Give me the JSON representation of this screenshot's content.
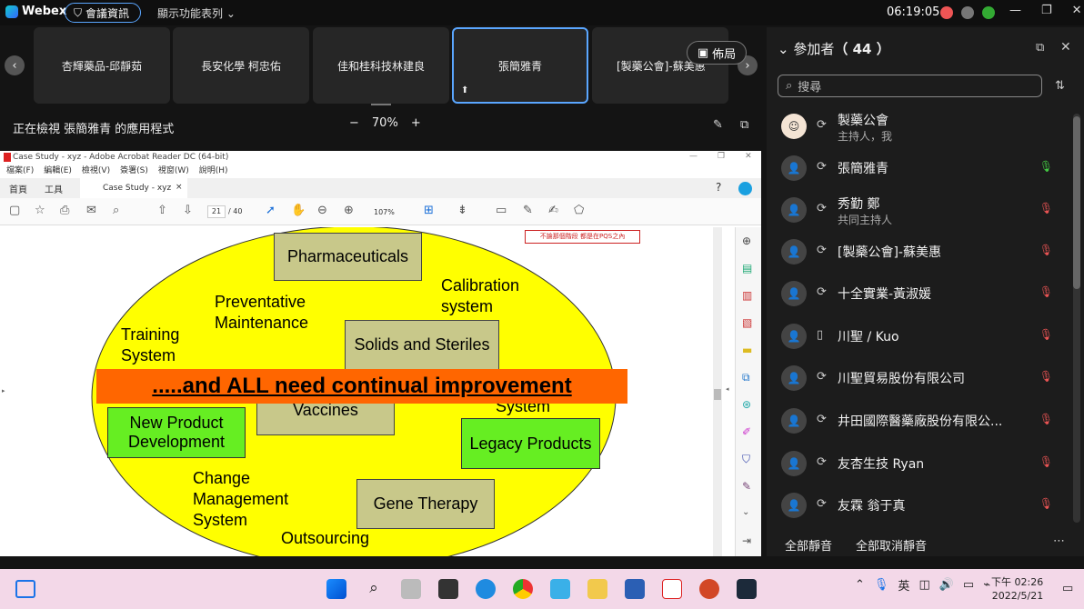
{
  "app": {
    "name": "Webex",
    "meeting_info": "會議資訊",
    "show_menu": "顯示功能表列",
    "clock": "06:19:05"
  },
  "strip": {
    "tiles": [
      "杏輝藥品-邱靜茹",
      "長安化學 柯忠佑",
      "佳和桂科技林建良",
      "張簡雅青",
      "[製藥公會]-蘇美惠"
    ],
    "layout": "佈局"
  },
  "viewing": {
    "text": "正在檢視 張簡雅青 的應用程式",
    "zoom": "70%"
  },
  "doc": {
    "window_title": "Case Study - xyz - Adobe Acrobat Reader DC (64-bit)",
    "menu": [
      "檔案(F)",
      "編輯(E)",
      "檢視(V)",
      "簽署(S)",
      "視窗(W)",
      "說明(H)"
    ],
    "tabs": [
      "首頁",
      "工具",
      "Case Study - xyz"
    ],
    "page_num": "21",
    "page_total": "/ 40",
    "zoom": "107%",
    "note": "不論那個階段 都是在PQS之內",
    "slide": {
      "pharma": "Pharmaceuticals",
      "calib": "Calibration\nsystem",
      "prevent": "Preventative\nMaintenance",
      "training": "Training\nSystem",
      "solids": "Solids and Steriles",
      "banner": ".....and ALL need continual improvement",
      "vaccines": "Vaccines",
      "system": "System",
      "newprod": "New Product\nDevelopment",
      "legacy": "Legacy Products",
      "change": "Change\nManagement\nSystem",
      "gene": "Gene Therapy",
      "outsourcing": "Outsourcing"
    }
  },
  "panel": {
    "title": "參加者",
    "count": "（ 44 ）",
    "search_placeholder": "搜尋",
    "participants": [
      {
        "name": "製藥公會",
        "sub": "主持人，我"
      },
      {
        "name": "張簡雅青",
        "sub": ""
      },
      {
        "name": "秀勤 鄭",
        "sub": "共同主持人"
      },
      {
        "name": "[製藥公會]-蘇美惠",
        "sub": ""
      },
      {
        "name": "十全實業-黃淑媛",
        "sub": ""
      },
      {
        "name": "川聖 / Kuo",
        "sub": ""
      },
      {
        "name": "川聖貿易股份有限公司",
        "sub": ""
      },
      {
        "name": "井田國際醫藥廠股份有限公...",
        "sub": ""
      },
      {
        "name": "友杏生技 Ryan",
        "sub": ""
      },
      {
        "name": "友霖 翁于真",
        "sub": ""
      }
    ],
    "mute_all": "全部靜音",
    "unmute_all": "全部取消靜音"
  },
  "taskbar": {
    "ime": "英",
    "time": "下午 02:26",
    "date": "2022/5/21"
  }
}
